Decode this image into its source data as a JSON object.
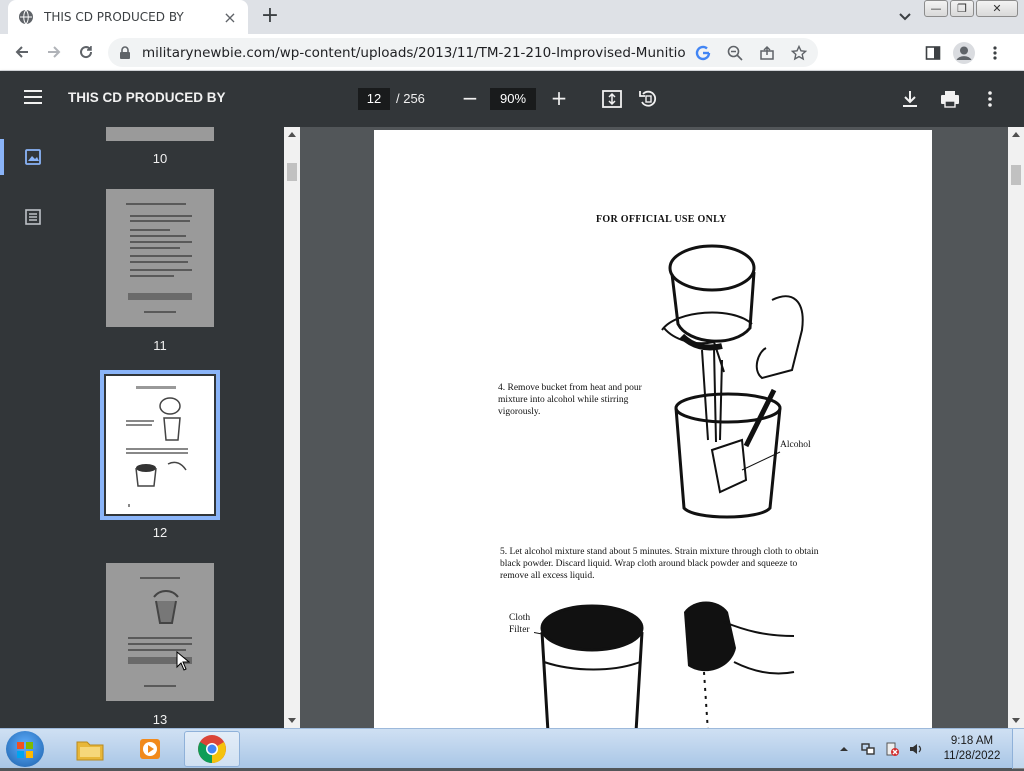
{
  "browser": {
    "tab_title": "THIS CD PRODUCED BY",
    "tab_close": "×",
    "new_tab": "+",
    "url": "militarynewbie.com/wp-content/uploads/2013/11/TM-21-210-Improvised-Munitions-Handbook-1969...",
    "window_buttons": [
      "—",
      "❐",
      "✕"
    ]
  },
  "pdf_toolbar": {
    "title": "THIS CD PRODUCED BY",
    "current_page": "12",
    "total_pages": "/ 256",
    "zoom": "90%",
    "zoom_minus": "−",
    "zoom_plus": "+"
  },
  "sidebar": {
    "thumbnails": [
      {
        "label": "10"
      },
      {
        "label": "11"
      },
      {
        "label": "12",
        "selected": true
      },
      {
        "label": "13"
      }
    ]
  },
  "document": {
    "header": "FOR OFFICIAL USE ONLY",
    "step4": "4.   Remove bucket from heat and pour mixture into alcohol while stirring vigorously.",
    "label_alcohol": "Alcohol",
    "step5": "5.   Let alcohol mixture stand about 5 minutes.  Strain mixture through cloth to obtain black powder.  Discard liquid.  Wrap cloth around black powder and squeeze to remove all excess liquid.",
    "label_cloth": "Cloth Filter"
  },
  "taskbar": {
    "time": "9:18 AM",
    "date": "11/28/2022"
  },
  "colors": {
    "pdf_toolbar": "#323639",
    "doc_background": "#525659",
    "selection": "#8ab4f8"
  }
}
